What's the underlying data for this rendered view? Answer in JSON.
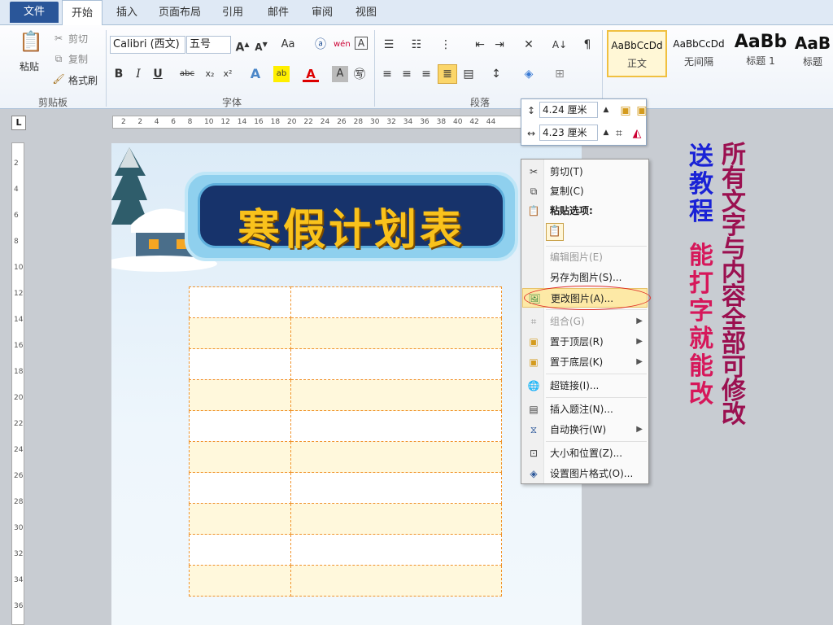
{
  "tabs": [
    "文件",
    "开始",
    "插入",
    "页面布局",
    "引用",
    "邮件",
    "审阅",
    "视图"
  ],
  "ribbon": {
    "clipboard": {
      "paste": "粘贴",
      "cut": "剪切",
      "copy": "复制",
      "format_painter": "格式刷",
      "label": "剪贴板"
    },
    "font": {
      "name": "Calibri (西文)",
      "size": "五号",
      "label": "字体"
    },
    "paragraph": {
      "label": "段落"
    },
    "styles": [
      {
        "preview": "AaBbCcDd",
        "name": "正文"
      },
      {
        "preview": "AaBbCcDd",
        "name": "无间隔"
      },
      {
        "preview": "AaBb",
        "name": "标题 1"
      },
      {
        "preview": "AaB",
        "name": "标题"
      }
    ]
  },
  "ruler_h": [
    "2",
    "2",
    "4",
    "6",
    "8",
    "10",
    "12",
    "14",
    "16",
    "18",
    "20",
    "22",
    "24",
    "26",
    "28",
    "30",
    "32",
    "34",
    "36",
    "38",
    "40",
    "42",
    "44"
  ],
  "ruler_v": [
    "2",
    "4",
    "6",
    "8",
    "10",
    "12",
    "14",
    "16",
    "18",
    "20",
    "22",
    "24",
    "26",
    "28",
    "30",
    "32",
    "34",
    "36"
  ],
  "size_mini": {
    "height": "4.24 厘米",
    "width": "4.23 厘米"
  },
  "document": {
    "title": "寒假计划表",
    "rows": 10
  },
  "context_menu": {
    "cut": "剪切(T)",
    "copy": "复制(C)",
    "paste_options": "粘贴选项:",
    "edit_picture": "编辑图片(E)",
    "save_as_picture": "另存为图片(S)...",
    "change_picture": "更改图片(A)...",
    "group": "组合(G)",
    "bring_front": "置于顶层(R)",
    "send_back": "置于底层(K)",
    "hyperlink": "超链接(I)...",
    "insert_caption": "插入题注(N)...",
    "wrap_text": "自动换行(W)",
    "size_position": "大小和位置(Z)...",
    "format_picture": "设置图片格式(O)..."
  },
  "side_text": {
    "col1": "送教程",
    "col2": "能打字就能改",
    "col3": "所有文字与内容全部可修改"
  },
  "colors": {
    "title_yellow": "#f9c21c",
    "banner_navy": "#17336b",
    "accent_blue": "#1a22d6",
    "accent_red": "#d6175a",
    "highlight": "#fde9a6"
  }
}
